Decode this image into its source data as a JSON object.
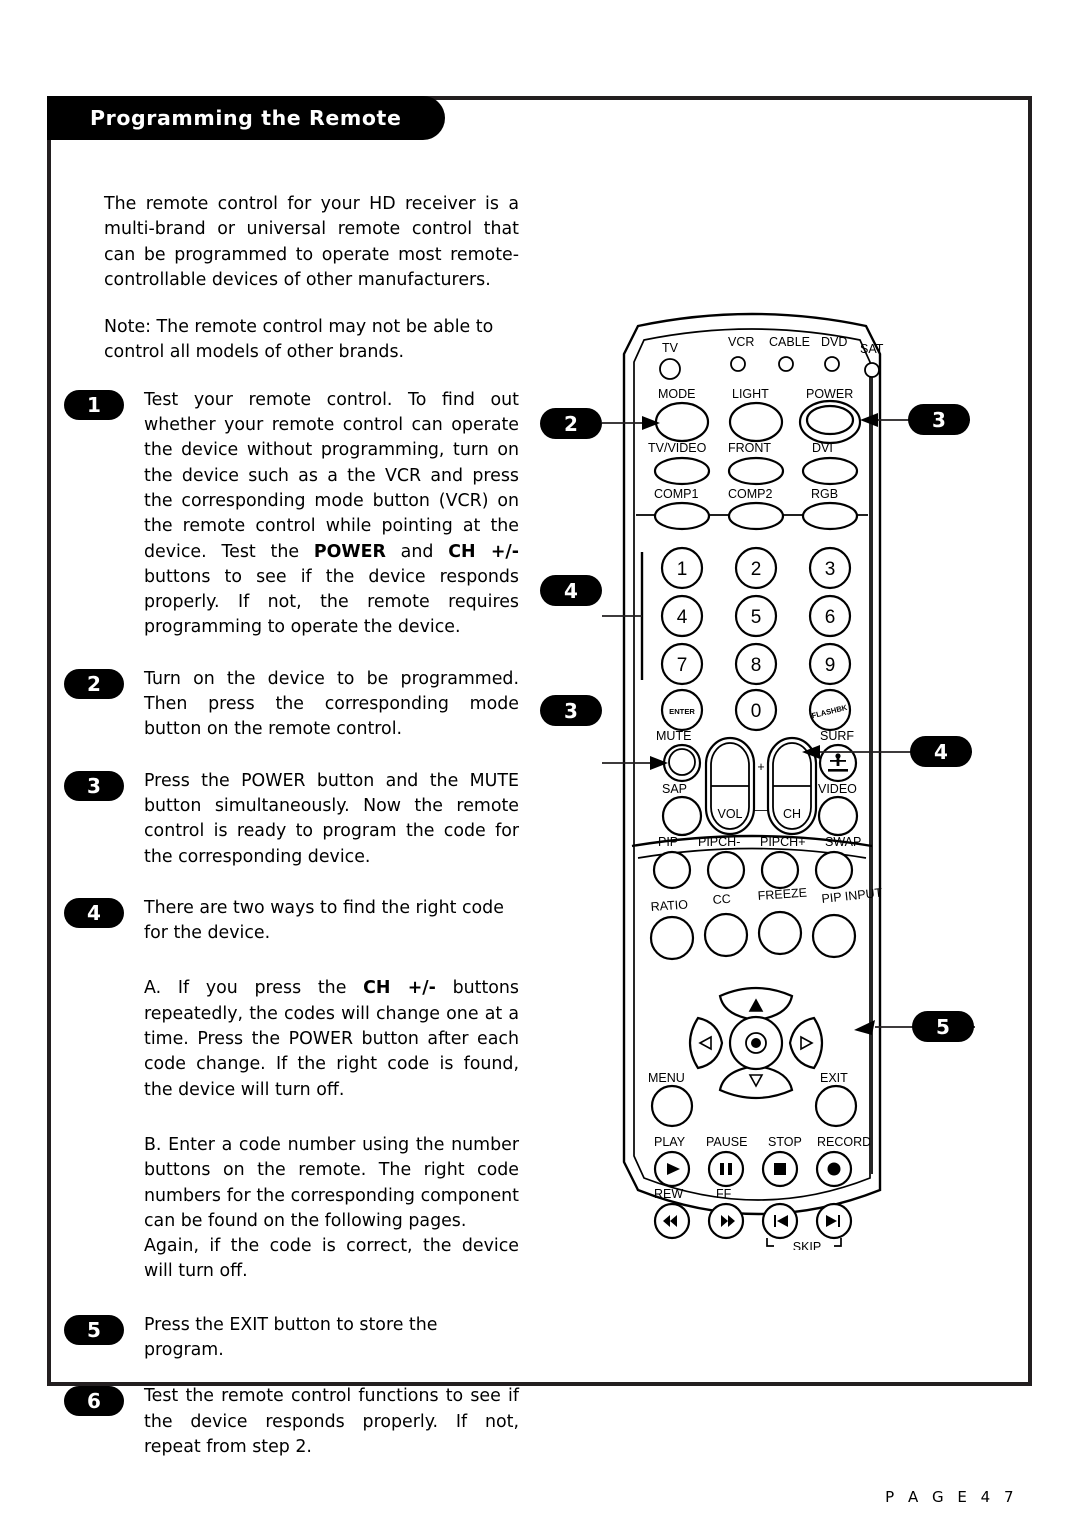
{
  "header": {
    "title": "Programming the Remote"
  },
  "footer": {
    "page_label": "P A G E   4 7"
  },
  "intro": {
    "paragraph1": "The remote control for your HD receiver is a multi-brand or universal remote control that can be programmed to operate most remote-controllable devices of other manufacturers.",
    "paragraph2": "Note: The remote control may not be able to control all models of other brands."
  },
  "steps": [
    {
      "number": "1",
      "text_before_bold1": "Test your remote control.\nTo find out whether your remote control can operate the device without programming, turn on the device such as a the VCR and press the corresponding mode button (VCR) on the remote control while pointing at the device. Test the ",
      "bold1": "POWER",
      "middle": " and ",
      "bold2": "CH +/-",
      "text_after": " buttons to see if the device responds properly. If not, the remote requires programming to operate the device."
    },
    {
      "number": "2",
      "text": "Turn on the device to be programmed. Then press the corresponding mode button on the remote control."
    },
    {
      "number": "3",
      "text": "Press the POWER button and the MUTE button simultaneously. Now the remote control is ready to program the code for the corresponding device."
    },
    {
      "number": "4",
      "text": "There are two ways to find the right code for the device."
    },
    {
      "number": "5",
      "text": "Press the EXIT button to store the program."
    },
    {
      "number": "6",
      "text": "Test the remote control functions to see if the device responds properly. If not, repeat from step 2."
    }
  ],
  "substeps": {
    "a_prefix": "A. If  you press the ",
    "a_bold": "CH +/-",
    "a_suffix": " buttons repeatedly, the codes will change one at a time. Press the POWER button after each code change. If the right code is found, the device will turn off.",
    "b_text": "B. Enter a code number using the number buttons on the remote. The right code numbers for the corresponding component can be found on the following pages.\nAgain, if the code is correct, the device will turn off."
  },
  "remote": {
    "callouts": [
      {
        "id": "left-2",
        "label": "2",
        "points_to": "MODE"
      },
      {
        "id": "right-3",
        "label": "3",
        "points_to": "POWER"
      },
      {
        "id": "left-4",
        "label": "4",
        "points_to": "number-keypad"
      },
      {
        "id": "left-3",
        "label": "3",
        "points_to": "MUTE"
      },
      {
        "id": "right-4",
        "label": "4",
        "points_to": "CH"
      },
      {
        "id": "right-5",
        "label": "5",
        "points_to": "EXIT"
      }
    ],
    "indicator_leds": [
      "TV",
      "VCR",
      "CABLE",
      "DVD",
      "SAT"
    ],
    "row_mode": [
      "MODE",
      "LIGHT",
      "POWER"
    ],
    "row_input1": [
      "TV/VIDEO",
      "FRONT",
      "DVI"
    ],
    "row_input2": [
      "COMP1",
      "COMP2",
      "RGB"
    ],
    "keypad": [
      "1",
      "2",
      "3",
      "4",
      "5",
      "6",
      "7",
      "8",
      "9",
      "ENTER",
      "0",
      "FLASHBK"
    ],
    "row_mute": [
      "MUTE",
      "SURF"
    ],
    "rocker_vol": "VOL",
    "rocker_ch": "CH",
    "rocker_plus": "+",
    "rocker_minus": "—",
    "row_sap": [
      "SAP",
      "VIDEO"
    ],
    "row_pip": [
      "PIP",
      "PIPCH-",
      "PIPCH+",
      "SWAP"
    ],
    "row_ratio": [
      "RATIO",
      "CC",
      "FREEZE",
      "PIP INPUT"
    ],
    "nav": {
      "menu": "MENU",
      "exit": "EXIT"
    },
    "transport_top": [
      "PLAY",
      "PAUSE",
      "STOP",
      "RECORD"
    ],
    "transport_bottom": [
      "REW",
      "FF"
    ],
    "skip_label": "SKIP"
  }
}
